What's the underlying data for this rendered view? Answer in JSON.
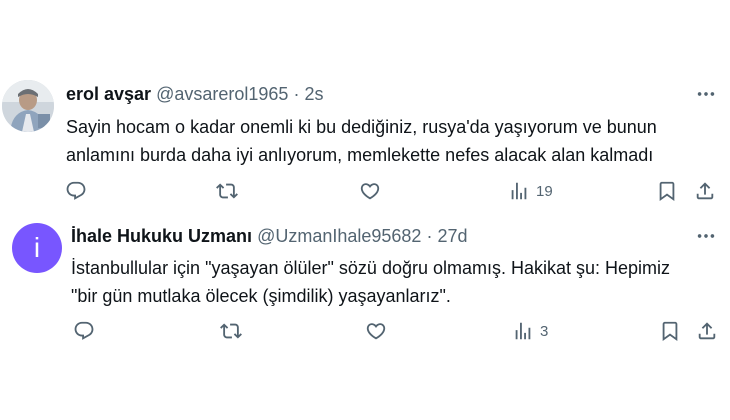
{
  "tweets": [
    {
      "name": "erol avşar",
      "handle": "@avsarerol1965",
      "separator": "·",
      "time": "2s",
      "avatar_icon": "user-photo-avatar",
      "text_lines": [
        "Sayin hocam o kadar onemli ki bu dediğiniz,  rusya'da yaşıyorum ve bunun",
        "anlamını burda daha iyi anlıyorum,  memlekette nefes alacak alan kalmadı"
      ],
      "views": "19"
    },
    {
      "name": "İhale Hukuku Uzmanı",
      "handle": "@UzmanIhale95682",
      "separator": "·",
      "time": "27d",
      "avatar_letter": "i",
      "text_lines": [
        "İstanbullular için \"yaşayan ölüler\" sözü doğru olmamış. Hakikat şu: Hepimiz",
        "\"bir gün mutlaka ölecek (şimdilik) yaşayanlarız\"."
      ],
      "views": "3"
    }
  ],
  "colors": {
    "text_primary": "#0f1419",
    "text_secondary": "#536471",
    "avatar_letter_bg": "#7856ff",
    "background": "#ffffff"
  }
}
